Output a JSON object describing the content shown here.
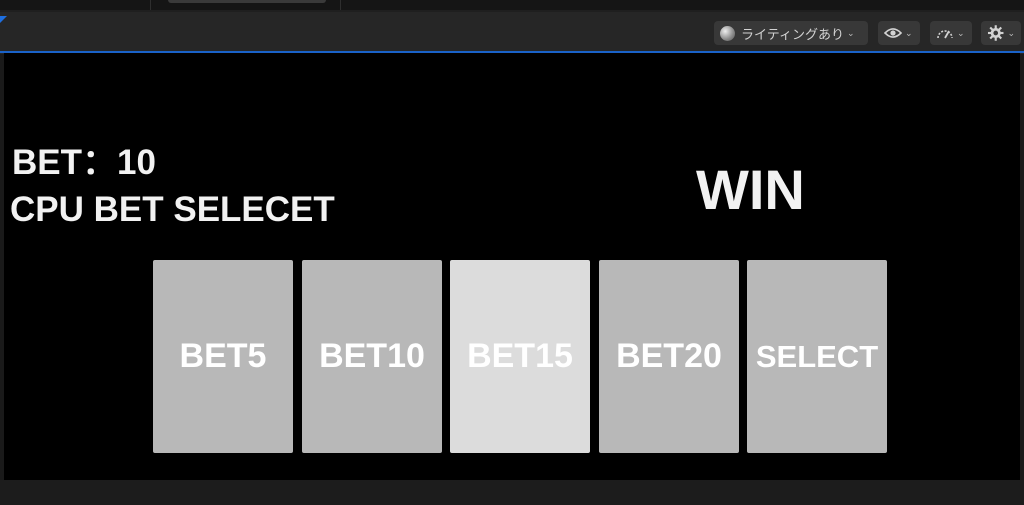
{
  "toolbar": {
    "lighting_label": "ライティングあり",
    "view_icon": "eye-icon",
    "performance_icon": "gauge-icon",
    "settings_icon": "gear-icon"
  },
  "game": {
    "bet_display": "BET：10",
    "cpu_status": "CPU BET SELECET",
    "result": "WIN",
    "buttons": [
      "BET5",
      "BET10",
      "BET15",
      "BET20",
      "SELECT"
    ],
    "hovered_button": "BET15"
  },
  "colors": {
    "accent": "#1a62c8",
    "button_bg": "#b8b8b8",
    "button_hover_bg": "#dcdcdc",
    "viewport_bg": "#000000"
  }
}
